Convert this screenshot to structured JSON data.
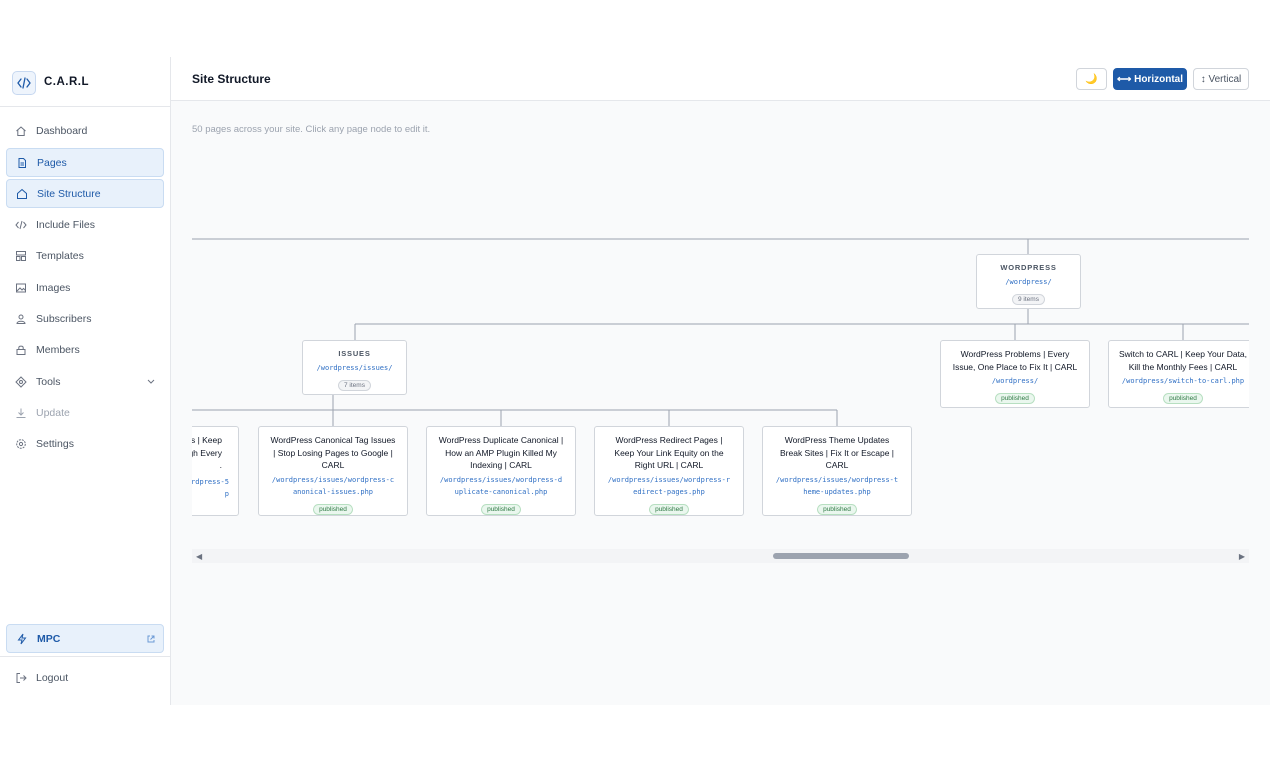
{
  "brand": {
    "name": "C.A.R.L"
  },
  "sidebar": {
    "items": [
      {
        "label": "Dashboard",
        "icon": "home-icon"
      },
      {
        "label": "Pages",
        "icon": "file-icon"
      },
      {
        "label": "Site Structure",
        "icon": "sitemap-icon"
      },
      {
        "label": "Include Files",
        "icon": "code-icon"
      },
      {
        "label": "Templates",
        "icon": "template-icon"
      },
      {
        "label": "Images",
        "icon": "image-icon"
      },
      {
        "label": "Subscribers",
        "icon": "subscribers-icon"
      },
      {
        "label": "Members",
        "icon": "lock-icon"
      },
      {
        "label": "Tools",
        "icon": "tools-icon"
      },
      {
        "label": "Update",
        "icon": "download-icon"
      },
      {
        "label": "Settings",
        "icon": "gear-icon"
      }
    ],
    "mpc": {
      "label": "MPC",
      "icon": "bolt-icon"
    },
    "logout": {
      "label": "Logout",
      "icon": "logout-icon"
    }
  },
  "header": {
    "title": "Site Structure",
    "theme_toggle": "🌙",
    "horizontal": "⟷ Horizontal",
    "vertical": "↕ Vertical"
  },
  "summary": "50 pages across your site. Click any page node to edit it.",
  "tree": {
    "wordpress": {
      "name": "WORDPRESS",
      "path": "/wordpress/",
      "count": "9 items"
    },
    "issues": {
      "name": "ISSUES",
      "path": "/wordpress/issues/",
      "count": "7 items"
    },
    "pages": [
      {
        "title_lines": [
          "WordPress Problems | Every",
          "Issue, One Place to Fix It | CARL"
        ],
        "path_lines": [
          "/wordpress/"
        ],
        "status": "published"
      },
      {
        "title_lines": [
          "Switch to CARL | Keep Your Data,",
          "Kill the Monthly Fees | CARL"
        ],
        "path_lines": [
          "/wordpress/switch-to-carl.php"
        ],
        "status": "published"
      },
      {
        "title_lines": [
          "s | Keep",
          "gh Every",
          "."
        ],
        "path_lines": [
          "ordpress-5",
          "p"
        ],
        "status": ""
      },
      {
        "title_lines": [
          "WordPress Canonical Tag Issues",
          "| Stop Losing Pages to Google |",
          "CARL"
        ],
        "path_lines": [
          "/wordpress/issues/wordpress-c",
          "anonical-issues.php"
        ],
        "status": "published"
      },
      {
        "title_lines": [
          "WordPress Duplicate Canonical |",
          "How an AMP Plugin Killed My",
          "Indexing | CARL"
        ],
        "path_lines": [
          "/wordpress/issues/wordpress-d",
          "uplicate-canonical.php"
        ],
        "status": "published"
      },
      {
        "title_lines": [
          "WordPress Redirect Pages |",
          "Keep Your Link Equity on the",
          "Right URL | CARL"
        ],
        "path_lines": [
          "/wordpress/issues/wordpress-r",
          "edirect-pages.php"
        ],
        "status": "published"
      },
      {
        "title_lines": [
          "WordPress Theme Updates",
          "Break Sites | Fix It or Escape |",
          "CARL"
        ],
        "path_lines": [
          "/wordpress/issues/wordpress-t",
          "heme-updates.php"
        ],
        "status": "published"
      }
    ]
  },
  "scrollbar": {
    "left": "◀",
    "right": "▶"
  }
}
